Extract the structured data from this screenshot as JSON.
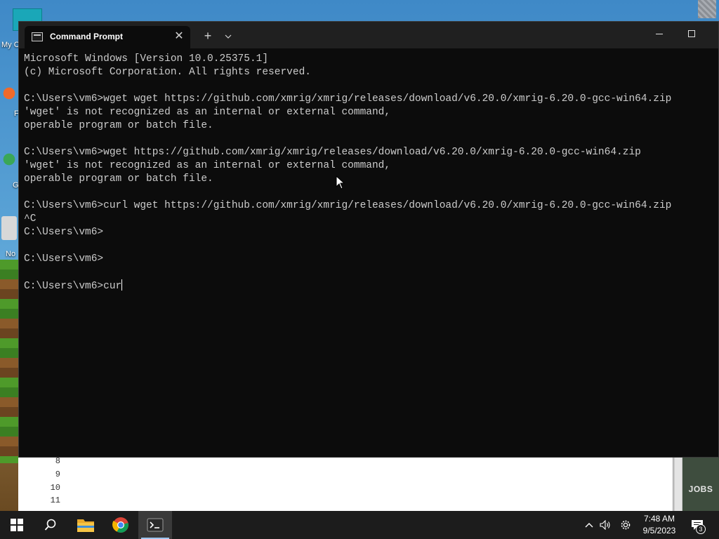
{
  "desktop": {
    "labels": [
      "My C",
      "F",
      "G",
      "No"
    ]
  },
  "window": {
    "tab_title": "Command Prompt",
    "tab_close": "✕",
    "new_tab": "+",
    "tab_dropdown": "⌵"
  },
  "console": {
    "lines": [
      "Microsoft Windows [Version 10.0.25375.1]",
      "(c) Microsoft Corporation. All rights reserved.",
      "",
      "C:\\Users\\vm6>wget wget https://github.com/xmrig/xmrig/releases/download/v6.20.0/xmrig-6.20.0-gcc-win64.zip",
      "'wget' is not recognized as an internal or external command,",
      "operable program or batch file.",
      "",
      "C:\\Users\\vm6>wget https://github.com/xmrig/xmrig/releases/download/v6.20.0/xmrig-6.20.0-gcc-win64.zip",
      "'wget' is not recognized as an internal or external command,",
      "operable program or batch file.",
      "",
      "C:\\Users\\vm6>curl wget https://github.com/xmrig/xmrig/releases/download/v6.20.0/xmrig-6.20.0-gcc-win64.zip",
      "^C",
      "C:\\Users\\vm6>",
      "",
      "C:\\Users\\vm6>",
      ""
    ],
    "prompt": "C:\\Users\\vm6>",
    "current_input": "cur"
  },
  "background_editor": {
    "line_numbers": [
      "8",
      "9",
      "10",
      "11"
    ],
    "jobs_label": "JOBS"
  },
  "taskbar": {
    "apps": [
      "start-icon",
      "search-icon",
      "file-explorer-icon",
      "chrome-icon",
      "terminal-icon"
    ],
    "clock_time": "7:48 AM",
    "clock_date": "9/5/2023",
    "notification_count": "3"
  },
  "colors": {
    "console_bg": "#0c0c0c",
    "console_text": "#cccccc",
    "titlebar_bg": "#202020",
    "taskbar_bg": "#1c1c1c"
  }
}
